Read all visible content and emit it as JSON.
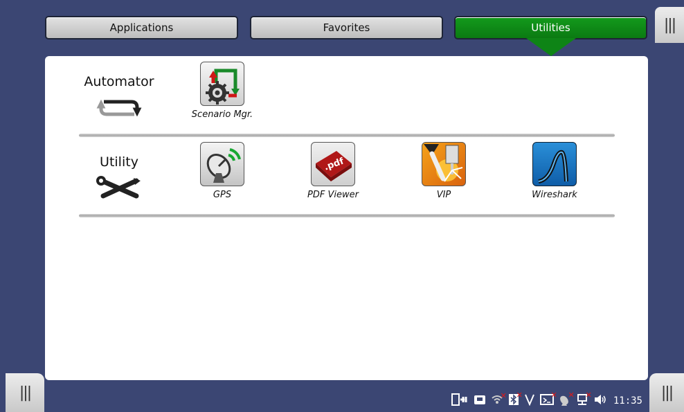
{
  "tabs": [
    {
      "label": "Applications",
      "active": false
    },
    {
      "label": "Favorites",
      "active": false
    },
    {
      "label": "Utilities",
      "active": true
    }
  ],
  "side_buttons": {
    "glyph": "|||"
  },
  "sections": {
    "automator": {
      "label": "Automator"
    },
    "utility": {
      "label": "Utility"
    }
  },
  "apps": {
    "scenario_mgr": {
      "label": "Scenario Mgr.",
      "icon": "scenario-manager-icon"
    },
    "gps": {
      "label": "GPS",
      "icon": "gps-satellite-dish-icon"
    },
    "pdf_viewer": {
      "label": "PDF Viewer",
      "icon": "pdf-icon"
    },
    "vip": {
      "label": "VIP",
      "icon": "vip-probe-icon"
    },
    "wireshark": {
      "label": "Wireshark",
      "icon": "wireshark-fin-icon"
    }
  },
  "status": {
    "clock": "11:35",
    "pdf_badge": ".pdf"
  },
  "colors": {
    "background": "#3b4673",
    "active_tab": "#0e8416",
    "error_mark": "#e01818"
  }
}
